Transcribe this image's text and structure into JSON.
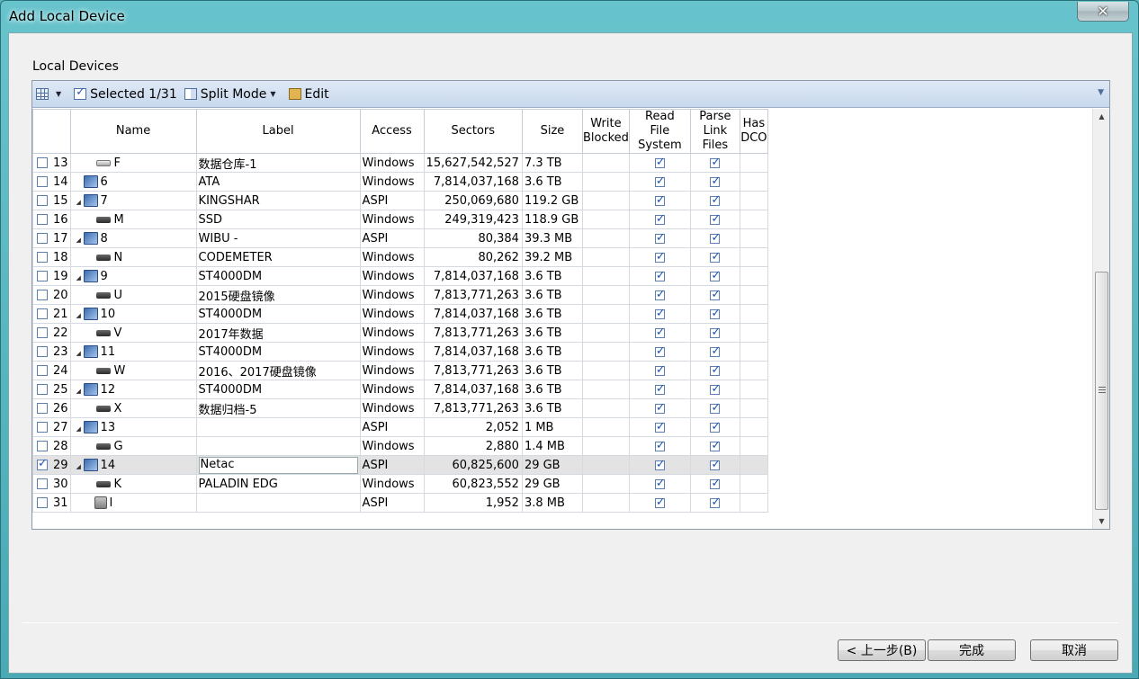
{
  "window": {
    "title": "Add Local Device",
    "close_glyph": "✕"
  },
  "group_label": "Local Devices",
  "toolbar": {
    "selected_label": "Selected 1/31",
    "split_mode_label": "Split Mode",
    "edit_label": "Edit"
  },
  "columns": {
    "name": "Name",
    "label": "Label",
    "access": "Access",
    "sectors": "Sectors",
    "size": "Size",
    "write_blocked_1": "Write",
    "write_blocked_2": "Blocked",
    "read_fs_1": "Read",
    "read_fs_2": "File System",
    "parse_link_1": "Parse",
    "parse_link_2": "Link Files",
    "has_dco_1": "Has",
    "has_dco_2": "DCO"
  },
  "rows": [
    {
      "idx": "13",
      "checked": false,
      "kind": "vol-light",
      "expand": false,
      "name": "F",
      "label": "数据仓库-1",
      "access": "Windows",
      "sectors": "15,627,542,527",
      "size": "7.3 TB"
    },
    {
      "idx": "14",
      "checked": false,
      "kind": "disk",
      "expand": false,
      "name": "6",
      "label": "ATA",
      "access": "Windows",
      "sectors": "7,814,037,168",
      "size": "3.6 TB"
    },
    {
      "idx": "15",
      "checked": false,
      "kind": "disk",
      "expand": true,
      "name": "7",
      "label": "KINGSHAR",
      "access": "ASPI",
      "sectors": "250,069,680",
      "size": "119.2 GB"
    },
    {
      "idx": "16",
      "checked": false,
      "kind": "vol",
      "expand": false,
      "name": "M",
      "label": "SSD",
      "access": "Windows",
      "sectors": "249,319,423",
      "size": "118.9 GB"
    },
    {
      "idx": "17",
      "checked": false,
      "kind": "disk",
      "expand": true,
      "name": "8",
      "label": "WIBU -",
      "access": "ASPI",
      "sectors": "80,384",
      "size": "39.3 MB"
    },
    {
      "idx": "18",
      "checked": false,
      "kind": "vol",
      "expand": false,
      "name": "N",
      "label": "CODEMETER",
      "access": "Windows",
      "sectors": "80,262",
      "size": "39.2 MB"
    },
    {
      "idx": "19",
      "checked": false,
      "kind": "disk",
      "expand": true,
      "name": "9",
      "label": "ST4000DM",
      "access": "Windows",
      "sectors": "7,814,037,168",
      "size": "3.6 TB"
    },
    {
      "idx": "20",
      "checked": false,
      "kind": "vol",
      "expand": false,
      "name": "U",
      "label": "2015硬盘镜像",
      "access": "Windows",
      "sectors": "7,813,771,263",
      "size": "3.6 TB"
    },
    {
      "idx": "21",
      "checked": false,
      "kind": "disk",
      "expand": true,
      "name": "10",
      "label": "ST4000DM",
      "access": "Windows",
      "sectors": "7,814,037,168",
      "size": "3.6 TB"
    },
    {
      "idx": "22",
      "checked": false,
      "kind": "vol",
      "expand": false,
      "name": "V",
      "label": "2017年数据",
      "access": "Windows",
      "sectors": "7,813,771,263",
      "size": "3.6 TB"
    },
    {
      "idx": "23",
      "checked": false,
      "kind": "disk",
      "expand": true,
      "name": "11",
      "label": "ST4000DM",
      "access": "Windows",
      "sectors": "7,814,037,168",
      "size": "3.6 TB"
    },
    {
      "idx": "24",
      "checked": false,
      "kind": "vol",
      "expand": false,
      "name": "W",
      "label": "2016、2017硬盘镜像",
      "access": "Windows",
      "sectors": "7,813,771,263",
      "size": "3.6 TB"
    },
    {
      "idx": "25",
      "checked": false,
      "kind": "disk",
      "expand": true,
      "name": "12",
      "label": "ST4000DM",
      "access": "Windows",
      "sectors": "7,814,037,168",
      "size": "3.6 TB"
    },
    {
      "idx": "26",
      "checked": false,
      "kind": "vol",
      "expand": false,
      "name": "X",
      "label": "数据归档-5",
      "access": "Windows",
      "sectors": "7,813,771,263",
      "size": "3.6 TB"
    },
    {
      "idx": "27",
      "checked": false,
      "kind": "disk",
      "expand": true,
      "name": "13",
      "label": "",
      "access": "ASPI",
      "sectors": "2,052",
      "size": "1 MB"
    },
    {
      "idx": "28",
      "checked": false,
      "kind": "vol",
      "expand": false,
      "name": "G",
      "label": "",
      "access": "Windows",
      "sectors": "2,880",
      "size": "1.4 MB"
    },
    {
      "idx": "29",
      "checked": true,
      "kind": "disk",
      "expand": true,
      "name": "14",
      "label": "Netac",
      "access": "ASPI",
      "sectors": "60,825,600",
      "size": "29 GB",
      "selected": true
    },
    {
      "idx": "30",
      "checked": false,
      "kind": "vol",
      "expand": false,
      "name": "K",
      "label": "PALADIN EDG",
      "access": "Windows",
      "sectors": "60,823,552",
      "size": "29 GB"
    },
    {
      "idx": "31",
      "checked": false,
      "kind": "usb",
      "expand": false,
      "name": "I",
      "label": "",
      "access": "ASPI",
      "sectors": "1,952",
      "size": "3.8 MB"
    }
  ],
  "buttons": {
    "back": "< 上一步(B)",
    "finish": "完成",
    "cancel": "取消"
  }
}
